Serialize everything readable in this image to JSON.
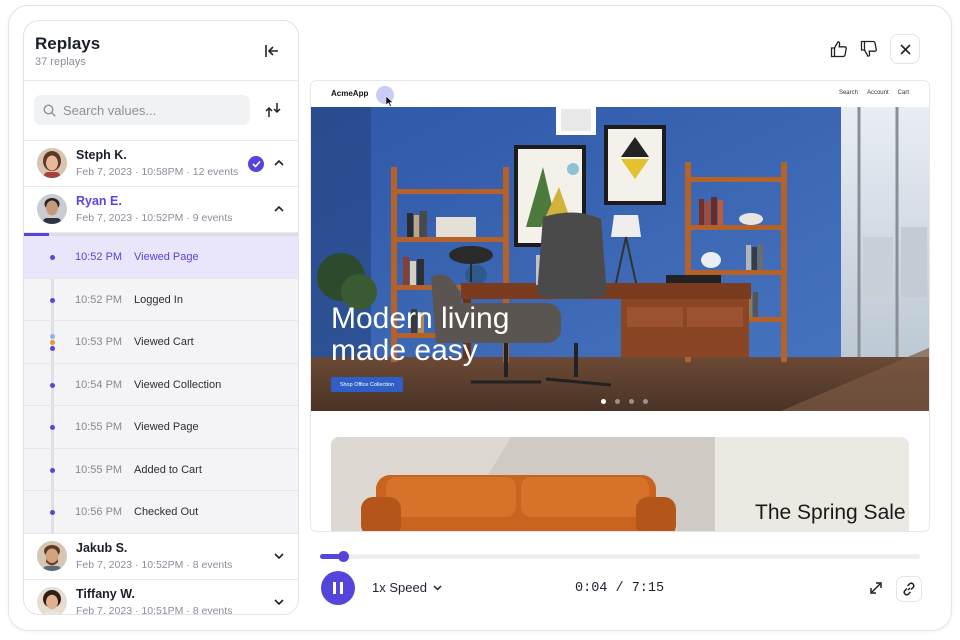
{
  "sidebar": {
    "title": "Replays",
    "count": "37 replays",
    "search_placeholder": "Search values...",
    "users": [
      {
        "name": "Steph K.",
        "meta": "Feb 7, 2023 · 10:58PM · 12 events",
        "checked": true,
        "expanded": true
      },
      {
        "name": "Ryan E.",
        "meta": "Feb 7, 2023 · 10:52PM · 9 events",
        "active": true,
        "expanded": true
      },
      {
        "name": "Jakub S.",
        "meta": "Feb 7, 2023 · 10:52PM · 8 events",
        "expanded": false
      },
      {
        "name": "Tiffany W.",
        "meta": "Feb 7, 2023 · 10:51PM · 8 events",
        "expanded": false
      }
    ],
    "session_progress": 0.09,
    "events": [
      {
        "time": "10:52 PM",
        "label": "Viewed Page",
        "selected": true
      },
      {
        "time": "10:52 PM",
        "label": "Logged In"
      },
      {
        "time": "10:53 PM",
        "label": "Viewed Cart"
      },
      {
        "time": "10:54 PM",
        "label": "Viewed Collection"
      },
      {
        "time": "10:55 PM",
        "label": "Viewed Page"
      },
      {
        "time": "10:55 PM",
        "label": "Added to Cart"
      },
      {
        "time": "10:56 PM",
        "label": "Checked Out"
      }
    ]
  },
  "actions": {
    "like": "thumbs-up-icon",
    "dislike": "thumbs-down-icon",
    "close": "close-icon"
  },
  "site": {
    "logo": "AcmeApp",
    "nav": [
      "Search",
      "Account",
      "Cart"
    ],
    "hero_line1": "Modern living",
    "hero_line2": "made easy",
    "hero_button": "Shop Office Collection",
    "promo_title": "The Spring Sale",
    "slide_count": 4,
    "slide_active": 0
  },
  "player": {
    "speed": "1x Speed",
    "time": "0:04 / 7:15",
    "progress": 0.033
  },
  "colors": {
    "accent": "#5446db",
    "hero_wall": "#3d68b8",
    "sofa": "#c9631f"
  }
}
